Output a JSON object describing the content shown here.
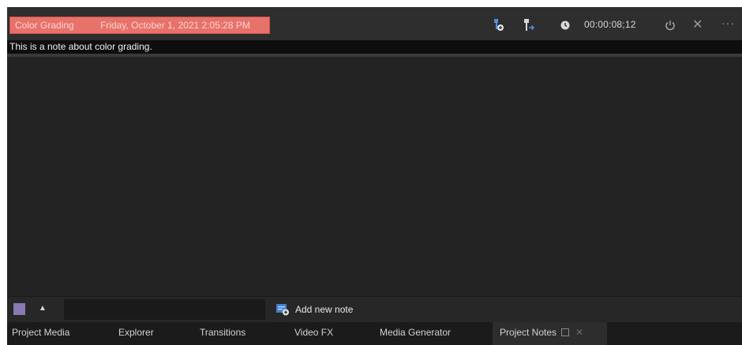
{
  "note": {
    "category": "Color Grading",
    "date": "Friday, October 1, 2021 2:05:28 PM",
    "timecode": "00:00:08;12",
    "text": "This is a note about color grading.",
    "tag_color": "#e8716a"
  },
  "header_icons": {
    "add_marker": "marker-add-icon",
    "goto_marker": "marker-goto-icon",
    "clock": "clock-icon",
    "power": "power-icon",
    "close": "close-icon",
    "more": "more-icon",
    "close_glyph": "✕",
    "more_glyph": "···"
  },
  "toolbar": {
    "swatch_color": "#8a78b3",
    "caret_glyph": "▲",
    "input_value": "",
    "add_note_label": "Add new note"
  },
  "tabs": [
    {
      "label": "Project Media"
    },
    {
      "label": "Explorer"
    },
    {
      "label": "Transitions"
    },
    {
      "label": "Video FX"
    },
    {
      "label": "Media Generator"
    },
    {
      "label": "Project Notes",
      "active": true,
      "close_glyph": "✕"
    }
  ]
}
